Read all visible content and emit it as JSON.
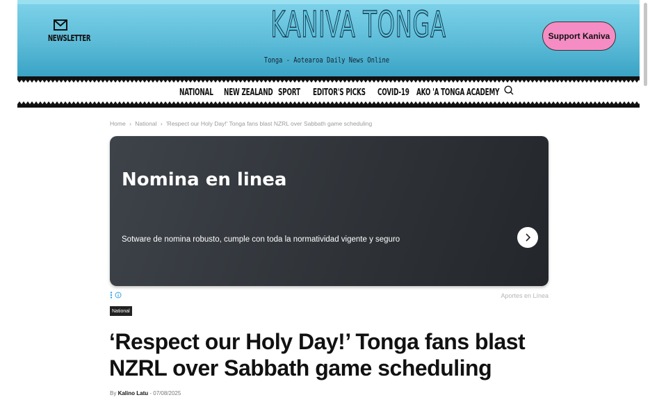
{
  "header": {
    "newsletter_label": "NEWSLETTER",
    "logo_title": "KANIVA TONGA",
    "logo_subtitle": "Tonga - Aotearoa Daily News Online",
    "support_label": "Support Kaniva"
  },
  "nav": {
    "items": [
      "NATIONAL",
      "NEW ZEALAND",
      "SPORT",
      "EDITOR'S PICKS",
      "COVID-19",
      "AKO 'A TONGA ACADEMY"
    ]
  },
  "breadcrumb": {
    "items": [
      "Home",
      "National",
      "'Respect our Holy Day!' Tonga fans blast NZRL over Sabbath game scheduling"
    ],
    "separator": "›"
  },
  "ad": {
    "title": "Nomina en linea",
    "text": "Sotware de nomina robusto, cumple con toda la normatividad vigente y seguro",
    "source": "Aportes en Línea"
  },
  "article": {
    "category": "National",
    "title": "‘Respect our Holy Day!’ Tonga fans blast NZRL over Sabbath game scheduling",
    "by_prefix": "By",
    "author": "Kalino Latu",
    "date_sep": "-",
    "date": "07/08/2025"
  },
  "colors": {
    "header_gradient_top": "#7fd3ea",
    "header_gradient_bottom": "#3aa3c5",
    "support_button": "#f58dc4",
    "ad_background": "#2f3338"
  }
}
